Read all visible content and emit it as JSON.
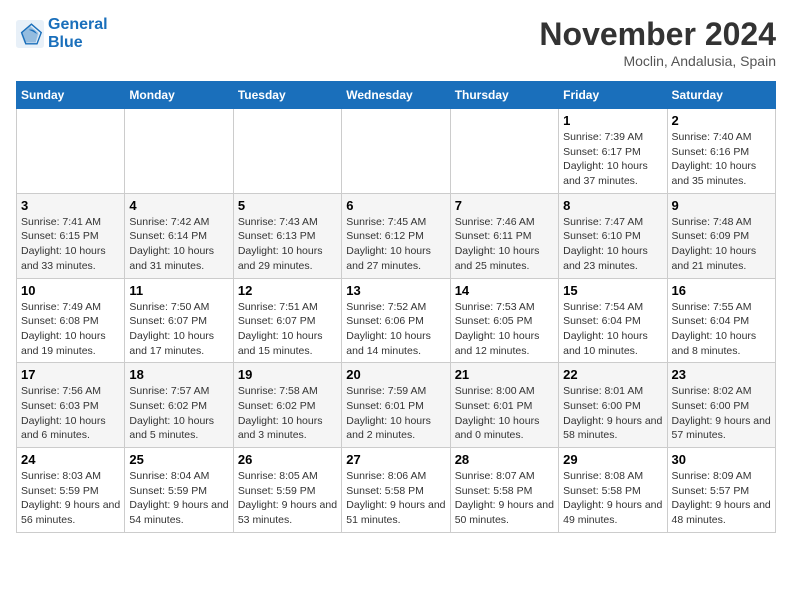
{
  "header": {
    "logo_line1": "General",
    "logo_line2": "Blue",
    "month": "November 2024",
    "location": "Moclin, Andalusia, Spain"
  },
  "days_of_week": [
    "Sunday",
    "Monday",
    "Tuesday",
    "Wednesday",
    "Thursday",
    "Friday",
    "Saturday"
  ],
  "weeks": [
    [
      {
        "num": "",
        "info": ""
      },
      {
        "num": "",
        "info": ""
      },
      {
        "num": "",
        "info": ""
      },
      {
        "num": "",
        "info": ""
      },
      {
        "num": "",
        "info": ""
      },
      {
        "num": "1",
        "info": "Sunrise: 7:39 AM\nSunset: 6:17 PM\nDaylight: 10 hours and 37 minutes."
      },
      {
        "num": "2",
        "info": "Sunrise: 7:40 AM\nSunset: 6:16 PM\nDaylight: 10 hours and 35 minutes."
      }
    ],
    [
      {
        "num": "3",
        "info": "Sunrise: 7:41 AM\nSunset: 6:15 PM\nDaylight: 10 hours and 33 minutes."
      },
      {
        "num": "4",
        "info": "Sunrise: 7:42 AM\nSunset: 6:14 PM\nDaylight: 10 hours and 31 minutes."
      },
      {
        "num": "5",
        "info": "Sunrise: 7:43 AM\nSunset: 6:13 PM\nDaylight: 10 hours and 29 minutes."
      },
      {
        "num": "6",
        "info": "Sunrise: 7:45 AM\nSunset: 6:12 PM\nDaylight: 10 hours and 27 minutes."
      },
      {
        "num": "7",
        "info": "Sunrise: 7:46 AM\nSunset: 6:11 PM\nDaylight: 10 hours and 25 minutes."
      },
      {
        "num": "8",
        "info": "Sunrise: 7:47 AM\nSunset: 6:10 PM\nDaylight: 10 hours and 23 minutes."
      },
      {
        "num": "9",
        "info": "Sunrise: 7:48 AM\nSunset: 6:09 PM\nDaylight: 10 hours and 21 minutes."
      }
    ],
    [
      {
        "num": "10",
        "info": "Sunrise: 7:49 AM\nSunset: 6:08 PM\nDaylight: 10 hours and 19 minutes."
      },
      {
        "num": "11",
        "info": "Sunrise: 7:50 AM\nSunset: 6:07 PM\nDaylight: 10 hours and 17 minutes."
      },
      {
        "num": "12",
        "info": "Sunrise: 7:51 AM\nSunset: 6:07 PM\nDaylight: 10 hours and 15 minutes."
      },
      {
        "num": "13",
        "info": "Sunrise: 7:52 AM\nSunset: 6:06 PM\nDaylight: 10 hours and 14 minutes."
      },
      {
        "num": "14",
        "info": "Sunrise: 7:53 AM\nSunset: 6:05 PM\nDaylight: 10 hours and 12 minutes."
      },
      {
        "num": "15",
        "info": "Sunrise: 7:54 AM\nSunset: 6:04 PM\nDaylight: 10 hours and 10 minutes."
      },
      {
        "num": "16",
        "info": "Sunrise: 7:55 AM\nSunset: 6:04 PM\nDaylight: 10 hours and 8 minutes."
      }
    ],
    [
      {
        "num": "17",
        "info": "Sunrise: 7:56 AM\nSunset: 6:03 PM\nDaylight: 10 hours and 6 minutes."
      },
      {
        "num": "18",
        "info": "Sunrise: 7:57 AM\nSunset: 6:02 PM\nDaylight: 10 hours and 5 minutes."
      },
      {
        "num": "19",
        "info": "Sunrise: 7:58 AM\nSunset: 6:02 PM\nDaylight: 10 hours and 3 minutes."
      },
      {
        "num": "20",
        "info": "Sunrise: 7:59 AM\nSunset: 6:01 PM\nDaylight: 10 hours and 2 minutes."
      },
      {
        "num": "21",
        "info": "Sunrise: 8:00 AM\nSunset: 6:01 PM\nDaylight: 10 hours and 0 minutes."
      },
      {
        "num": "22",
        "info": "Sunrise: 8:01 AM\nSunset: 6:00 PM\nDaylight: 9 hours and 58 minutes."
      },
      {
        "num": "23",
        "info": "Sunrise: 8:02 AM\nSunset: 6:00 PM\nDaylight: 9 hours and 57 minutes."
      }
    ],
    [
      {
        "num": "24",
        "info": "Sunrise: 8:03 AM\nSunset: 5:59 PM\nDaylight: 9 hours and 56 minutes."
      },
      {
        "num": "25",
        "info": "Sunrise: 8:04 AM\nSunset: 5:59 PM\nDaylight: 9 hours and 54 minutes."
      },
      {
        "num": "26",
        "info": "Sunrise: 8:05 AM\nSunset: 5:59 PM\nDaylight: 9 hours and 53 minutes."
      },
      {
        "num": "27",
        "info": "Sunrise: 8:06 AM\nSunset: 5:58 PM\nDaylight: 9 hours and 51 minutes."
      },
      {
        "num": "28",
        "info": "Sunrise: 8:07 AM\nSunset: 5:58 PM\nDaylight: 9 hours and 50 minutes."
      },
      {
        "num": "29",
        "info": "Sunrise: 8:08 AM\nSunset: 5:58 PM\nDaylight: 9 hours and 49 minutes."
      },
      {
        "num": "30",
        "info": "Sunrise: 8:09 AM\nSunset: 5:57 PM\nDaylight: 9 hours and 48 minutes."
      }
    ]
  ]
}
